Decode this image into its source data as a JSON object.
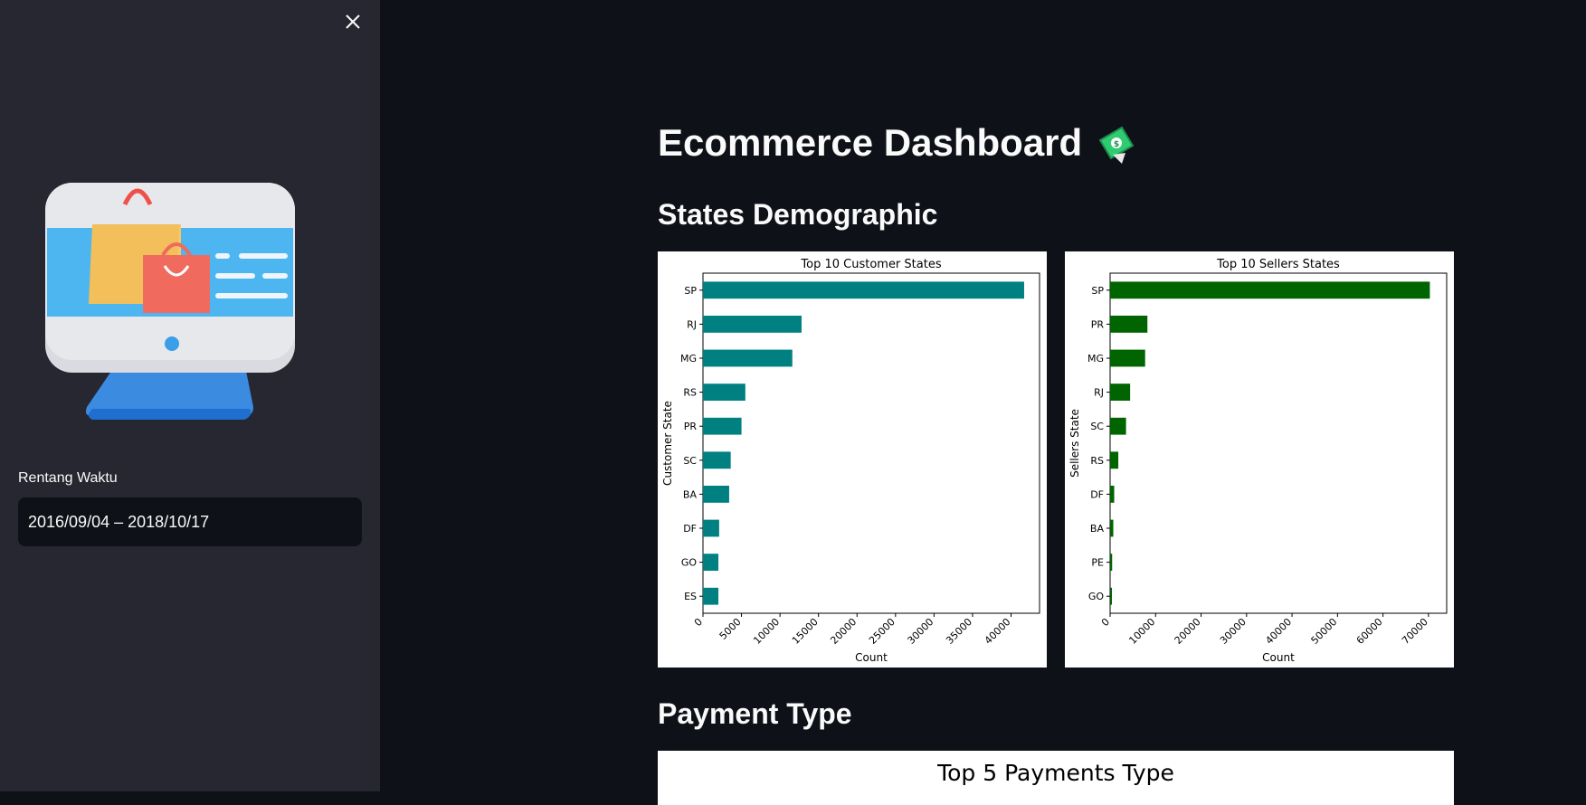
{
  "sidebar": {
    "date_label": "Rentang Waktu",
    "date_value": "2016/09/04 – 2018/10/17",
    "close_icon": "close-icon",
    "image": "shopping-monitor-illustration"
  },
  "main": {
    "title": "Ecommerce Dashboard",
    "title_icon": "money-with-wings-icon",
    "section_states": "States Demographic",
    "section_payment": "Payment Type",
    "payment_chart_title": "Top 5 Payments Type"
  },
  "colors": {
    "page_bg": "#0e1117",
    "sidebar_bg": "#262730",
    "customer_bar": "#008080",
    "seller_bar": "#006400"
  },
  "chart_data": [
    {
      "type": "bar",
      "orientation": "horizontal",
      "title": "Top 10 Customer States",
      "xlabel": "Count",
      "ylabel": "Customer State",
      "categories": [
        "SP",
        "RJ",
        "MG",
        "RS",
        "PR",
        "SC",
        "BA",
        "DF",
        "GO",
        "ES"
      ],
      "values": [
        41700,
        12800,
        11600,
        5500,
        5000,
        3600,
        3400,
        2100,
        2000,
        2000
      ],
      "xlim": [
        0,
        43700
      ],
      "xticks": [
        0,
        5000,
        10000,
        15000,
        20000,
        25000,
        30000,
        35000,
        40000
      ],
      "color": "#008080"
    },
    {
      "type": "bar",
      "orientation": "horizontal",
      "title": "Top 10 Sellers States",
      "xlabel": "Count",
      "ylabel": "Sellers State",
      "categories": [
        "SP",
        "PR",
        "MG",
        "RJ",
        "SC",
        "RS",
        "DF",
        "BA",
        "PE",
        "GO"
      ],
      "values": [
        70300,
        8200,
        7700,
        4400,
        3500,
        1800,
        900,
        700,
        450,
        400
      ],
      "xlim": [
        0,
        74000
      ],
      "xticks": [
        0,
        10000,
        20000,
        30000,
        40000,
        50000,
        60000,
        70000
      ],
      "color": "#006400"
    }
  ]
}
